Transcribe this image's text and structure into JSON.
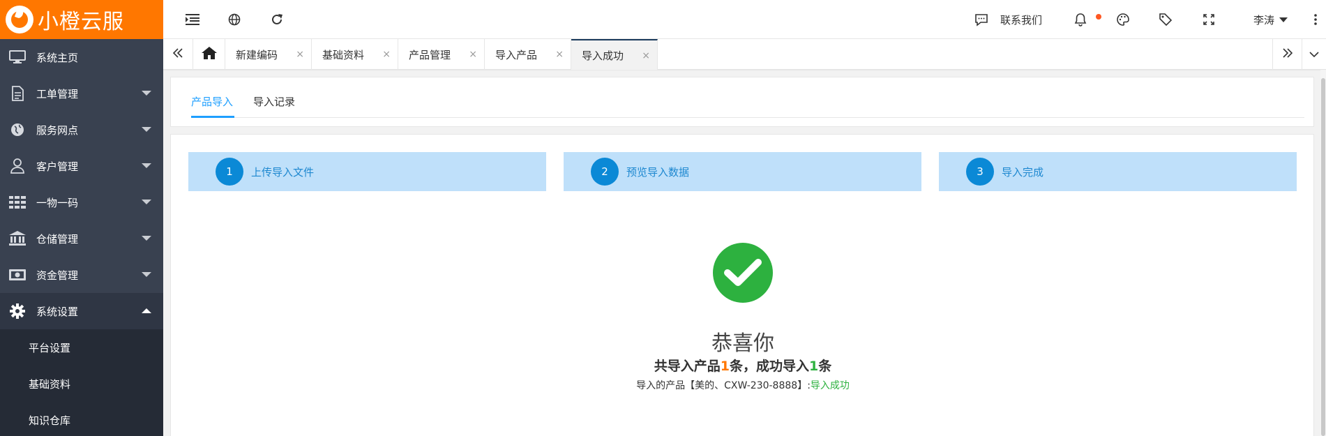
{
  "brand": {
    "name": "小橙云服",
    "color": "#ff7700"
  },
  "sidebar": {
    "items": [
      {
        "label": "系统主页",
        "icon": "monitor-icon",
        "has_caret": false
      },
      {
        "label": "工单管理",
        "icon": "document-icon",
        "has_caret": true
      },
      {
        "label": "服务网点",
        "icon": "globe-icon",
        "has_caret": true
      },
      {
        "label": "客户管理",
        "icon": "user-icon",
        "has_caret": true
      },
      {
        "label": "一物一码",
        "icon": "grid-icon",
        "has_caret": true
      },
      {
        "label": "仓储管理",
        "icon": "bank-icon",
        "has_caret": true
      },
      {
        "label": "资金管理",
        "icon": "money-icon",
        "has_caret": true
      },
      {
        "label": "系统设置",
        "icon": "gear-icon",
        "has_caret": true,
        "expanded": true
      }
    ],
    "sub_items": [
      "平台设置",
      "基础资料",
      "知识仓库"
    ]
  },
  "header": {
    "contact_label": "联系我们",
    "user_name": "李涛",
    "notification_dot_color": "#ff5722"
  },
  "tabs": [
    {
      "label": "新建编码",
      "closable": true
    },
    {
      "label": "基础资料",
      "closable": true
    },
    {
      "label": "产品管理",
      "closable": true
    },
    {
      "label": "导入产品",
      "closable": true
    },
    {
      "label": "导入成功",
      "closable": true,
      "active": true
    }
  ],
  "tab_close_glyph": "×",
  "content": {
    "subtabs": [
      {
        "label": "产品导入",
        "active": true
      },
      {
        "label": "导入记录",
        "active": false
      }
    ],
    "steps": [
      {
        "num": "1",
        "label": "上传导入文件"
      },
      {
        "num": "2",
        "label": "预览导入数据"
      },
      {
        "num": "3",
        "label": "导入完成"
      }
    ],
    "congrats": "恭喜你",
    "summary": {
      "prefix": "共导入产品",
      "total": "1",
      "middle": "条，成功导入",
      "success": "1",
      "suffix": "条"
    },
    "detail": {
      "text": "导入的产品【美的、CXW-230-8888】:",
      "status": "导入成功"
    }
  },
  "colors": {
    "sidebar_bg": "#394150",
    "step_bg": "#bfe0fa",
    "step_circle": "#0b89d6",
    "success_green": "#2db13f",
    "accent_blue": "#1e9fff"
  }
}
